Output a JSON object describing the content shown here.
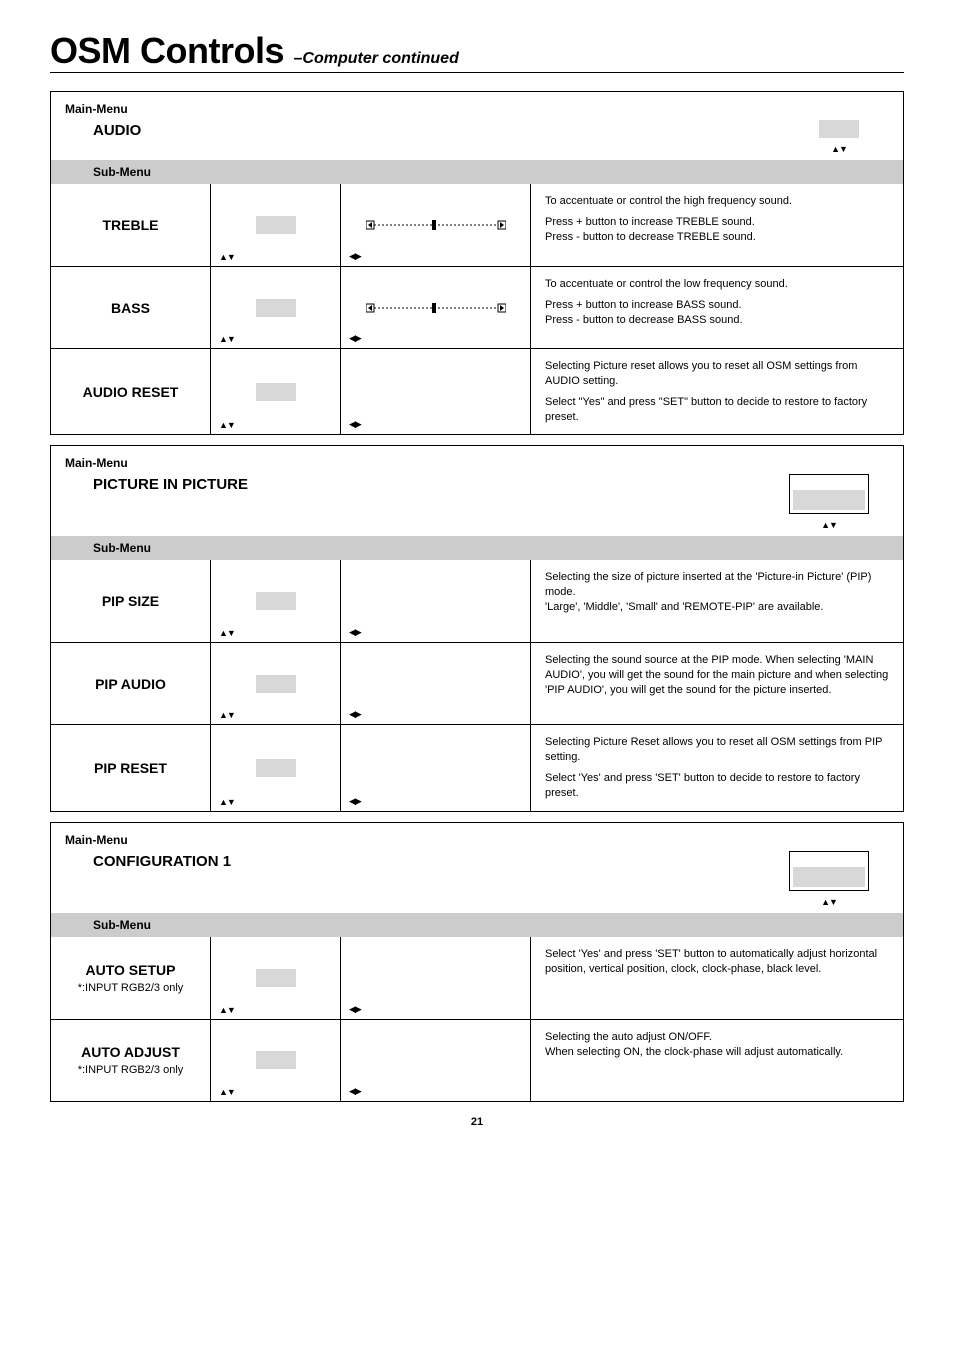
{
  "page": {
    "title_main": "OSM Controls",
    "title_sub": "–Computer continued",
    "page_number": "21"
  },
  "labels": {
    "main_menu": "Main-Menu",
    "sub_menu": "Sub-Menu",
    "arrows_ud": "▲▼",
    "arrows_lr": "◀▶"
  },
  "sections": [
    {
      "title": "AUDIO",
      "rows": [
        {
          "label": "TREBLE",
          "note": "",
          "has_slider": true,
          "desc": [
            "To accentuate or control the high frequency sound.",
            "Press + button to increase TREBLE sound.\nPress - button to decrease TREBLE sound."
          ]
        },
        {
          "label": "BASS",
          "note": "",
          "has_slider": true,
          "desc": [
            "To accentuate or control the low frequency sound.",
            "Press + button to increase BASS sound.\nPress - button to decrease BASS sound."
          ]
        },
        {
          "label": "AUDIO RESET",
          "note": "",
          "has_slider": false,
          "desc": [
            "Selecting Picture reset allows you to reset all OSM settings from AUDIO setting.",
            "Select \"Yes\" and press \"SET\" button to decide to restore to factory preset."
          ]
        }
      ]
    },
    {
      "title": "PICTURE IN PICTURE",
      "big_icon": true,
      "rows": [
        {
          "label": "PIP SIZE",
          "note": "",
          "has_slider": false,
          "desc": [
            "Selecting the size of picture inserted at the 'Picture-in Picture' (PIP) mode.\n'Large', 'Middle', 'Small' and 'REMOTE-PIP' are available."
          ]
        },
        {
          "label": "PIP AUDIO",
          "note": "",
          "has_slider": false,
          "desc": [
            "Selecting the sound source at the PIP mode. When selecting 'MAIN AUDIO', you will get the sound for the main picture and when selecting 'PIP AUDIO', you will get the sound for the picture inserted."
          ]
        },
        {
          "label": "PIP RESET",
          "note": "",
          "has_slider": false,
          "desc": [
            "Selecting Picture Reset allows you to reset all OSM settings from PIP setting.",
            "Select 'Yes' and press 'SET' button to decide to restore to factory preset."
          ]
        }
      ]
    },
    {
      "title": "CONFIGURATION 1",
      "big_icon": true,
      "rows": [
        {
          "label": "AUTO SETUP",
          "note": "*:INPUT RGB2/3 only",
          "has_slider": false,
          "hide_icon_placeholder": false,
          "desc": [
            "Select 'Yes' and press 'SET' button to automatically adjust horizontal position, vertical position, clock, clock-phase, black level."
          ]
        },
        {
          "label": "AUTO ADJUST",
          "note": "*:INPUT RGB2/3 only",
          "has_slider": false,
          "desc": [
            "Selecting the auto adjust ON/OFF.\nWhen selecting ON, the clock-phase will adjust automatically."
          ]
        }
      ]
    }
  ]
}
